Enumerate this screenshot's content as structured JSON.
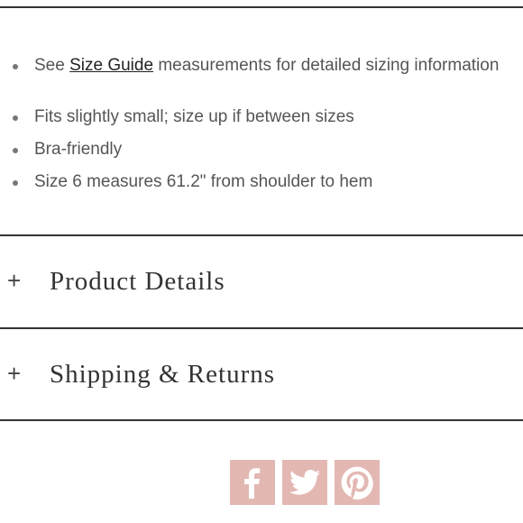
{
  "bullets": {
    "first": {
      "prefix": "See ",
      "link": "Size Guide",
      "suffix": " measurements for detailed sizing information"
    },
    "items": [
      "Fits slightly small; size up if between sizes",
      "Bra-friendly",
      "Size 6 measures 61.2\" from shoulder to hem"
    ]
  },
  "accordion": [
    {
      "icon": "+",
      "label": "Product Details"
    },
    {
      "icon": "+",
      "label": "Shipping & Returns"
    }
  ],
  "social": {
    "color": "#e3b8b3",
    "buttons": [
      {
        "icon": "facebook-icon"
      },
      {
        "icon": "twitter-icon"
      },
      {
        "icon": "pinterest-icon"
      }
    ]
  }
}
